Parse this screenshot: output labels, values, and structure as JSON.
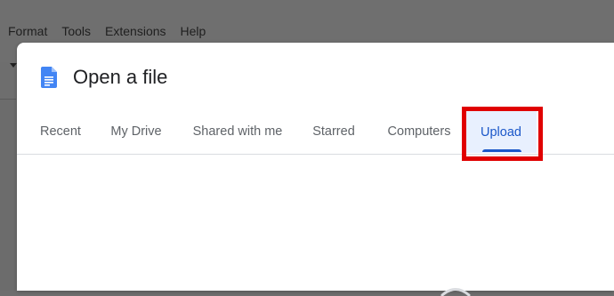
{
  "background": {
    "menu_items": [
      "Format",
      "Tools",
      "Extensions",
      "Help"
    ]
  },
  "dialog": {
    "title": "Open a file",
    "icon": "google-docs-icon",
    "tabs": [
      {
        "label": "Recent",
        "active": false
      },
      {
        "label": "My Drive",
        "active": false
      },
      {
        "label": "Shared with me",
        "active": false
      },
      {
        "label": "Starred",
        "active": false
      },
      {
        "label": "Computers",
        "active": false
      },
      {
        "label": "Upload",
        "active": true
      }
    ]
  },
  "colors": {
    "accent": "#1a57c9",
    "active_tab_bg": "#e8f0fe",
    "highlight": "#e00000",
    "docs_blue": "#4285f4"
  }
}
